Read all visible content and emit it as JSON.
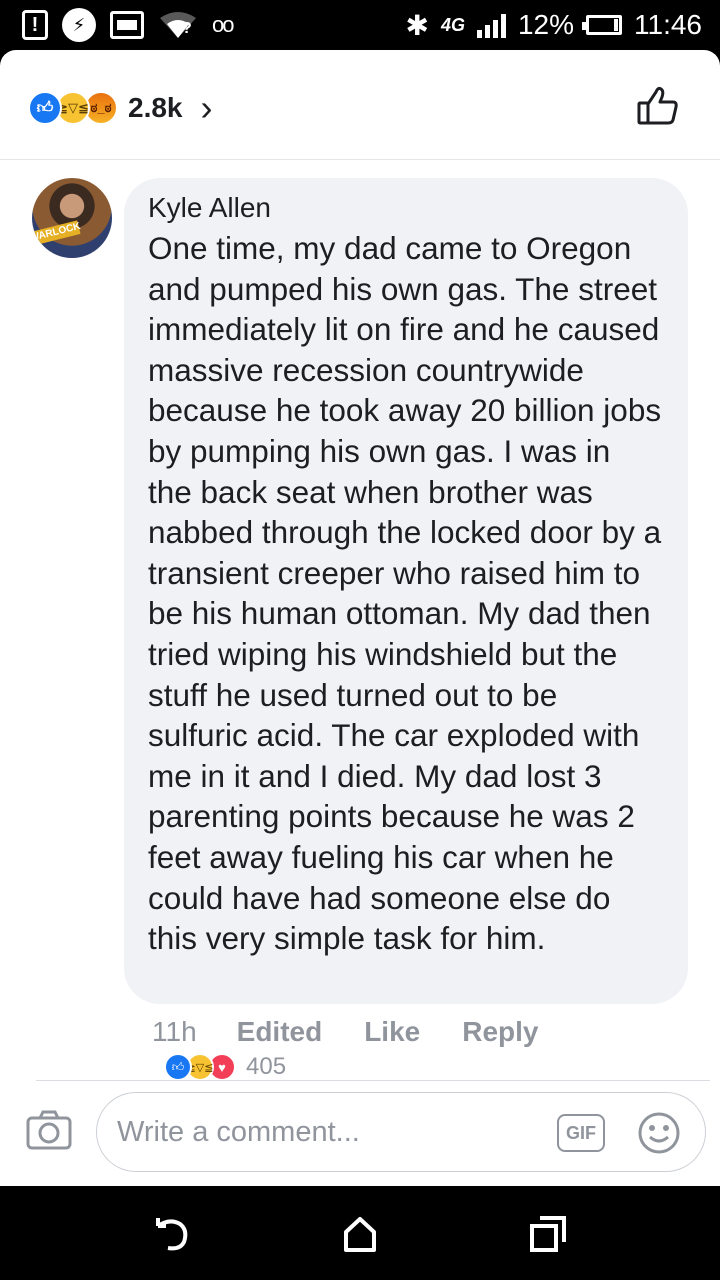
{
  "status_bar": {
    "wifi_badge": "?",
    "voicemail": "oo",
    "network": "4G",
    "battery_percent": "12%",
    "time": "11:46",
    "icons": [
      "alert-icon",
      "messenger-icon",
      "card-icon",
      "wifi-icon",
      "voicemail-icon",
      "bluetooth-icon",
      "signal-icon",
      "battery-icon"
    ]
  },
  "reactions_header": {
    "count": "2.8k",
    "chevron": "›",
    "icons": [
      "like-reaction-icon",
      "haha-reaction-icon",
      "angry-reaction-icon",
      "thumbs-up-outline-icon"
    ]
  },
  "comment": {
    "author": "Kyle Allen",
    "avatar_tag": "WARLOCK",
    "text": "One time, my dad came to Oregon and pumped his own gas. The street immediately lit on fire and he caused massive recession countrywide because he took away 20 billion jobs by pumping his own gas. I was in the back seat when brother was nabbed through the locked door by a transient creeper who raised him to be his human ottoman. My dad then tried wiping his windshield but the stuff he used turned out to be sulfuric acid. The car exploded with me in it and I died. My dad lost 3 parenting points because he was 2 feet away fueling his car when he could have had someone else do this very simple task for him.",
    "time": "11h",
    "edited_label": "Edited",
    "like_label": "Like",
    "reply_label": "Reply",
    "reaction_count": "405",
    "reaction_icons": [
      "like-reaction-icon",
      "haha-reaction-icon",
      "love-reaction-icon"
    ]
  },
  "composer": {
    "placeholder": "Write a comment...",
    "gif_label": "GIF",
    "icons": [
      "camera-icon",
      "sticker-smiley-icon"
    ]
  },
  "nav_bar": {
    "icons": [
      "back-icon",
      "home-icon",
      "recents-icon"
    ]
  },
  "colors": {
    "facebook_blue": "#1877f2",
    "bubble_gray": "#f0f2f5",
    "meta_gray": "#90949c",
    "text": "#1c1e21"
  }
}
